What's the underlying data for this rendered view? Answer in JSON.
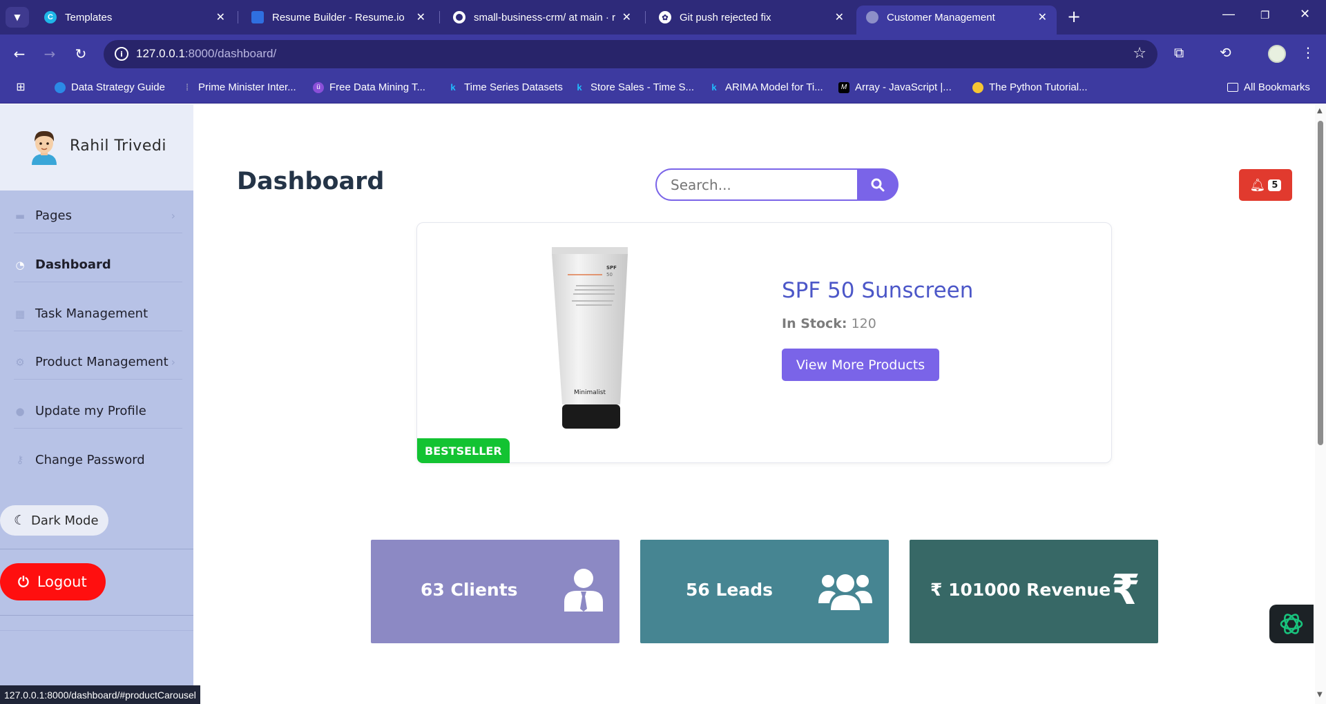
{
  "browser": {
    "tabs": [
      {
        "title": "Templates",
        "active": false
      },
      {
        "title": "Resume Builder - Resume.io",
        "active": false
      },
      {
        "title": "small-business-crm/ at main · ra",
        "active": false
      },
      {
        "title": "Git push rejected fix",
        "active": false
      },
      {
        "title": "Customer Management",
        "active": true
      }
    ],
    "url_host": "127.0.0.1",
    "url_path": ":8000/dashboard/",
    "bookmarks": [
      "Data Strategy Guide",
      "Prime Minister Inter...",
      "Free Data Mining T...",
      "Time Series Datasets",
      "Store Sales - Time S...",
      "ARIMA Model for Ti...",
      "Array - JavaScript |...",
      "The Python Tutorial..."
    ],
    "all_bookmarks": "All Bookmarks",
    "status_url": "127.0.0.1:8000/dashboard/#productCarousel"
  },
  "sidebar": {
    "user_name": "Rahil Trivedi",
    "items": [
      {
        "label": "Pages",
        "icon": "folder-icon",
        "has_chevron": true
      },
      {
        "label": "Dashboard",
        "icon": "speedometer-icon",
        "active": true
      },
      {
        "label": "Task Management",
        "icon": "calendar-icon"
      },
      {
        "label": "Product Management",
        "icon": "gears-icon",
        "has_chevron": true
      },
      {
        "label": "Update my Profile",
        "icon": "user-icon"
      },
      {
        "label": "Change Password",
        "icon": "key-icon"
      }
    ],
    "dark_mode_label": "Dark Mode",
    "logout_label": "Logout"
  },
  "header": {
    "title": "Dashboard",
    "search_placeholder": "Search...",
    "notification_count": "5"
  },
  "product": {
    "name": "SPF 50 Sunscreen",
    "stock_label": "In Stock:",
    "stock_value": "120",
    "badge": "BESTSELLER",
    "button_label": "View More Products",
    "image_brand": "Minimalist",
    "image_spf": "SPF 50"
  },
  "stats": [
    {
      "label": "63 Clients",
      "color": "#8c89c4",
      "icon": "client-icon"
    },
    {
      "label": "56 Leads",
      "color": "#468592",
      "icon": "users-icon"
    },
    {
      "label": "₹ 101000 Revenue",
      "color": "#376866",
      "icon": "rupee-icon"
    }
  ],
  "colors": {
    "accent": "#7a64e8",
    "browser_frame": "#3d3aa0",
    "sidebar": "#b7c2e6",
    "danger": "#e13a2e",
    "logout": "#ff0f0f",
    "bestseller": "#13c332",
    "title": "#243447",
    "product_name": "#4c57c8"
  }
}
